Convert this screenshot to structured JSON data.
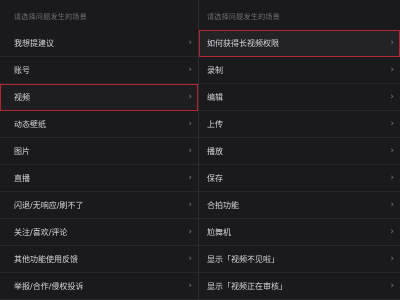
{
  "left_panel": {
    "hint": "请选择问题发生的场景",
    "items": [
      {
        "label": "我想提建议",
        "selected": false
      },
      {
        "label": "账号",
        "selected": false
      },
      {
        "label": "视频",
        "selected": true
      },
      {
        "label": "动态壁纸",
        "selected": false
      },
      {
        "label": "图片",
        "selected": false
      },
      {
        "label": "直播",
        "selected": false
      },
      {
        "label": "闪退/无响应/刷不了",
        "selected": false
      },
      {
        "label": "关注/喜欢/评论",
        "selected": false
      },
      {
        "label": "其他功能使用反馈",
        "selected": false
      },
      {
        "label": "举报/合作/侵权投诉",
        "selected": false
      }
    ]
  },
  "right_panel": {
    "hint": "请选择问题发生的场景",
    "items": [
      {
        "label": "如何获得长视频权限",
        "selected": true
      },
      {
        "label": "录制",
        "selected": false
      },
      {
        "label": "编辑",
        "selected": false
      },
      {
        "label": "上传",
        "selected": false
      },
      {
        "label": "播放",
        "selected": false
      },
      {
        "label": "保存",
        "selected": false
      },
      {
        "label": "合拍功能",
        "selected": false
      },
      {
        "label": "尬舞机",
        "selected": false
      },
      {
        "label": "显示「视频不见啦」",
        "selected": false
      },
      {
        "label": "显示「视频正在审核」",
        "selected": false
      }
    ]
  },
  "icons": {
    "chevron": "›",
    "chevron_name": "chevron-right-icon"
  },
  "colors": {
    "background": "#1a1a1d",
    "highlight_border": "#b3262e",
    "text": "#d9d9de",
    "hint": "#6f6f76"
  }
}
